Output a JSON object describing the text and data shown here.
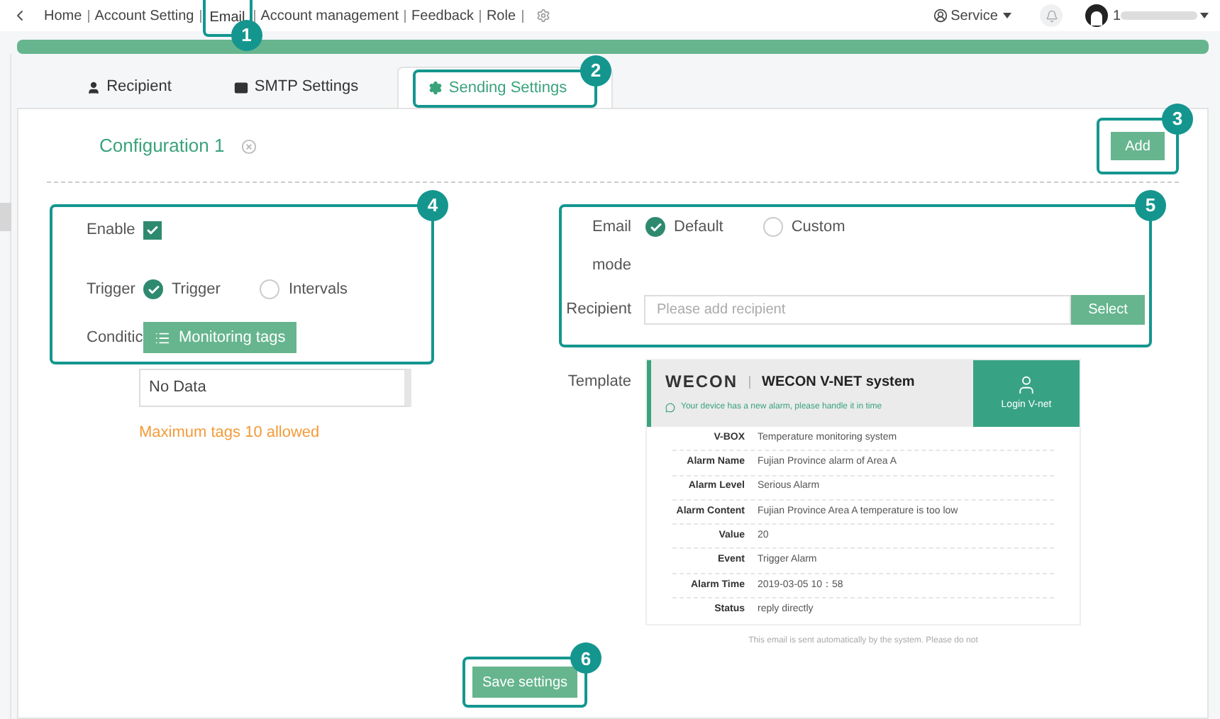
{
  "nav": {
    "links": [
      {
        "label": "Home",
        "selected": false
      },
      {
        "label": "Account Setting",
        "selected": false
      },
      {
        "label": "Email",
        "selected": true,
        "badge": "1"
      },
      {
        "label": "Account management",
        "selected": false
      },
      {
        "label": "Feedback",
        "selected": false
      },
      {
        "label": "Role",
        "selected": false
      }
    ],
    "service": "Service",
    "user_initial": "1"
  },
  "tabs": [
    {
      "label": "Recipient",
      "selected": false
    },
    {
      "label": "SMTP Settings",
      "selected": false
    },
    {
      "label": "Sending Settings",
      "selected": true,
      "badge": "2"
    }
  ],
  "config": {
    "title": "Configuration 1",
    "add_button": "Add",
    "add_badge": "3"
  },
  "left_group": {
    "badge": "4",
    "enable_label": "Enable",
    "enable_checked": true,
    "trigger_label": "Trigger",
    "trigger_options": [
      {
        "label": "Trigger",
        "selected": true
      },
      {
        "label": "Intervals",
        "selected": false
      }
    ],
    "condition_label": "Conditic",
    "tags_button": "Monitoring tags",
    "tags_list": "No Data",
    "limit_note": "Maximum tags 10 allowed"
  },
  "right_group": {
    "badge": "5",
    "mode_label_1": "Email",
    "mode_label_2": "mode",
    "mode_options": [
      {
        "label": "Default",
        "selected": true
      },
      {
        "label": "Custom",
        "selected": false
      }
    ],
    "recipient_label": "Recipient",
    "recipient_placeholder": "Please add recipient",
    "select_button": "Select"
  },
  "template": {
    "label": "Template",
    "logo": "WECON",
    "system": "WECON V-NET system",
    "message": "Your device has a new alarm, please handle it in time",
    "login": "Login V-net",
    "rows": [
      {
        "key": "V-BOX",
        "value": "Temperature monitoring system"
      },
      {
        "key": "Alarm Name",
        "value": "Fujian Province alarm of Area A"
      },
      {
        "key": "Alarm Level",
        "value": "Serious Alarm"
      },
      {
        "key": "Alarm Content",
        "value": "Fujian Province Area A temperature is too low"
      },
      {
        "key": "Value",
        "value": "20"
      },
      {
        "key": "Event",
        "value": "Trigger Alarm"
      },
      {
        "key": "Alarm Time",
        "value": "2019-03-05  10：58"
      },
      {
        "key": "Status",
        "value": "reply directly"
      }
    ],
    "footer": "This email is sent automatically by the system. Please do not"
  },
  "save": {
    "label": "Save settings",
    "badge": "6"
  }
}
